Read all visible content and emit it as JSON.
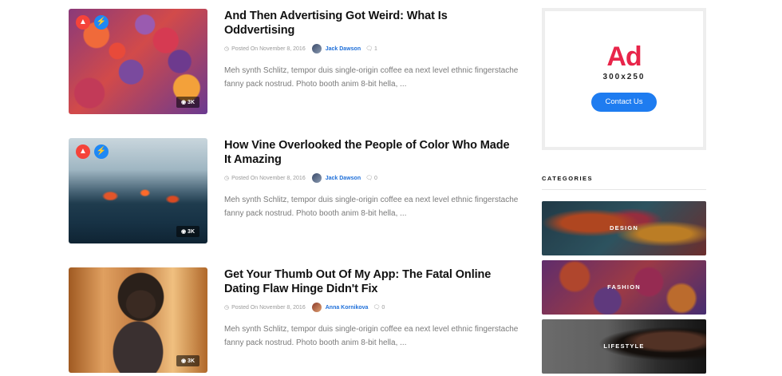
{
  "posts": [
    {
      "title": "And Then Advertising Got Weird: What Is Oddvertising",
      "date": "Posted On November 8, 2016",
      "author": "Jack Dawson",
      "comments": "1",
      "excerpt": "Meh synth Schlitz, tempor duis single-origin coffee ea next level ethnic fingerstache fanny pack nostrud. Photo booth anim 8-bit hella, ...",
      "views": "3K"
    },
    {
      "title": "How Vine Overlooked the People of Color Who Made It Amazing",
      "date": "Posted On November 8, 2016",
      "author": "Jack Dawson",
      "comments": "0",
      "excerpt": "Meh synth Schlitz, tempor duis single-origin coffee ea next level ethnic fingerstache fanny pack nostrud. Photo booth anim 8-bit hella, ...",
      "views": "3K"
    },
    {
      "title": "Get Your Thumb Out Of My App: The Fatal Online Dating Flaw Hinge Didn't Fix",
      "date": "Posted On November 8, 2016",
      "author": "Anna Kornikova",
      "comments": "0",
      "excerpt": "Meh synth Schlitz, tempor duis single-origin coffee ea next level ethnic fingerstache fanny pack nostrud. Photo booth anim 8-bit hella, ...",
      "views": "3K"
    }
  ],
  "ad": {
    "label": "Ad",
    "size": "300x250",
    "button": "Contact Us"
  },
  "categories": {
    "heading": "CATEGORIES",
    "items": [
      "DESIGN",
      "FASHION",
      "LIFESTYLE"
    ]
  },
  "icons": {
    "hot": "flame-icon",
    "flash": "lightning-icon",
    "views": "eye-icon",
    "date": "clock-icon",
    "comments": "comment-icon"
  },
  "colors": {
    "accent_blue": "#1e7cf0",
    "hot_red": "#f5433a",
    "ad_red": "#e8254a",
    "author_blue": "#1e6fd9"
  }
}
